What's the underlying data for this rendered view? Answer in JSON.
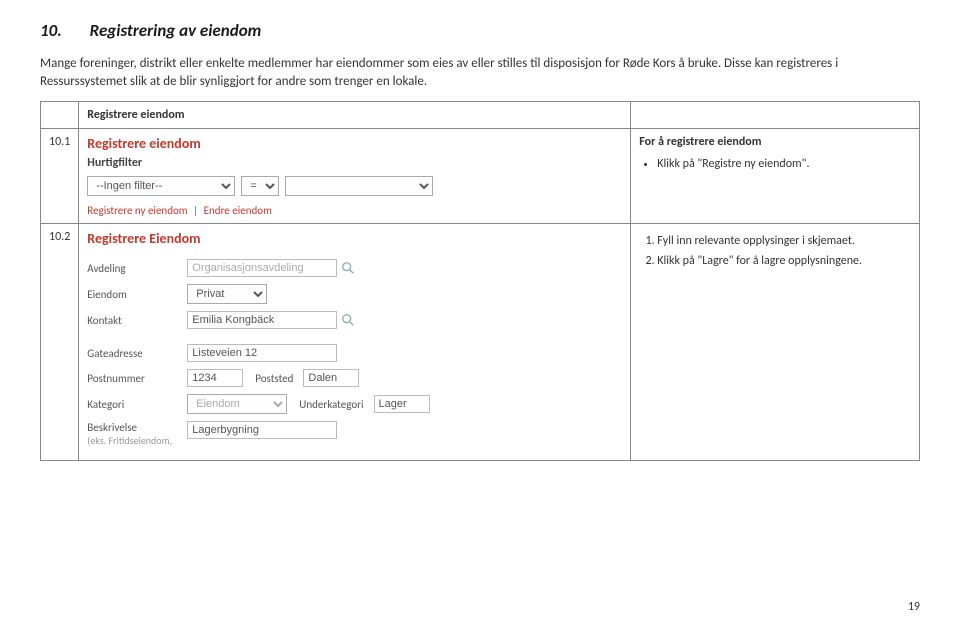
{
  "heading_num": "10.",
  "heading_text": "Registrering av eiendom",
  "intro": "Mange foreninger, distrikt eller enkelte medlemmer har eiendommer som eies av eller stilles til disposisjon for Røde Kors å bruke. Disse kan registreres i Ressurssystemet slik at de blir synliggjort for andre som trenger en lokale.",
  "table_header": "Registrere eiendom",
  "row1_num": "10.1",
  "row1": {
    "title": "Registrere eiendom",
    "subtitle": "Hurtigfilter",
    "filter_value": "--Ingen filter--",
    "eq": "=",
    "link1": "Registrere ny eiendom",
    "link2": "Endre eiendom",
    "desc_title": "For å registrere eiendom",
    "bullet": "Klikk på \"Registre ny eiendom\"."
  },
  "row2_num": "10.2",
  "row2": {
    "title": "Registrere Eiendom",
    "avdeling_label": "Avdeling",
    "avdeling_value": "Organisasjonsavdeling",
    "eiendom_label": "Eiendom",
    "eiendom_value": "Privat",
    "kontakt_label": "Kontakt",
    "kontakt_value": "Emilia Kongbäck",
    "gate_label": "Gateadresse",
    "gate_value": "Listeveien 12",
    "post_label": "Postnummer",
    "post_value": "1234",
    "poststed_label": "Poststed",
    "poststed_value": "Dalen",
    "kategori_label": "Kategori",
    "kategori_value": "Eiendom",
    "under_label": "Underkategori",
    "under_value": "Lager",
    "besk_label": "Beskrivelse",
    "besk_sub": "(eks. Fritidseiendom,",
    "besk_value": "Lagerbygning",
    "step1": "Fyll inn relevante opplysinger i skjemaet.",
    "step2": "Klikk på \"Lagre\" for å lagre opplysningene."
  },
  "page_num": "19"
}
